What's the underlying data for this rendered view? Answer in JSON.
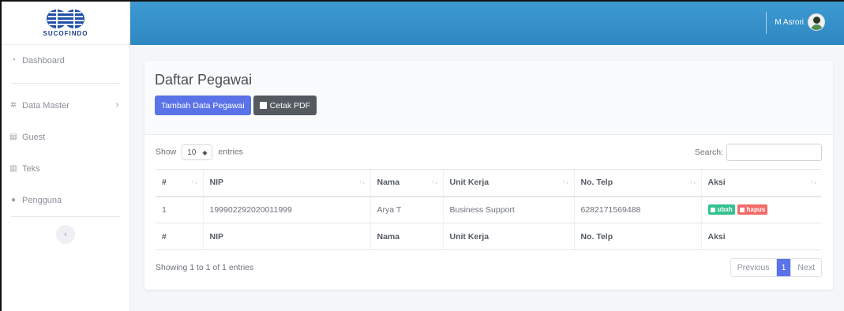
{
  "brand": {
    "name": "SUCOFINDO",
    "color": "#1a3f8a"
  },
  "topbar": {
    "user_name": "M Asrori",
    "color": "#3291c9"
  },
  "sidebar": {
    "items": [
      {
        "label": "Dashboard",
        "icon": "dashboard-icon"
      },
      {
        "label": "Data Master",
        "icon": "gear-icon"
      },
      {
        "label": "Guest",
        "icon": "file-icon"
      },
      {
        "label": "Teks",
        "icon": "list-icon"
      },
      {
        "label": "Pengguna",
        "icon": "user-icon"
      }
    ],
    "collapse_icon": "chevron-left-icon"
  },
  "page": {
    "title": "Daftar Pegawai",
    "add_button": "Tambah Data Pegawai",
    "pdf_button": "Cetak PDF",
    "accent": "#5b73e8"
  },
  "datatable": {
    "show_label": "Show",
    "length_value": "10",
    "entries_label": "entries",
    "search_label": "Search:",
    "search_value": "",
    "columns": [
      "#",
      "NIP",
      "Nama",
      "Unit Kerja",
      "No. Telp",
      "Aksi"
    ],
    "rows": [
      {
        "no": "1",
        "nip": "199902292020011999",
        "nama": "Arya T",
        "unit": "Business Support",
        "telp": "6282171569488",
        "edit": "ubah",
        "delete": "hapus"
      }
    ],
    "info": "Showing 1 to 1 of 1 entries",
    "pagination": {
      "previous": "Previous",
      "current": "1",
      "next": "Next"
    }
  }
}
